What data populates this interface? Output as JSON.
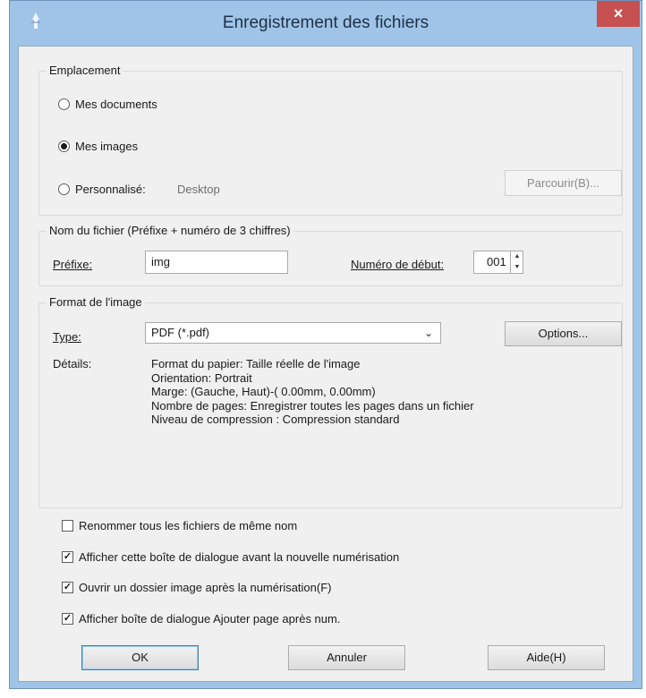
{
  "window": {
    "title": "Enregistrement des fichiers",
    "close_label": "×"
  },
  "location": {
    "legend": "Emplacement",
    "options": [
      {
        "label": "Mes documents",
        "checked": false
      },
      {
        "label": "Mes images",
        "checked": true
      },
      {
        "label": "Personnalisé:",
        "checked": false
      }
    ],
    "custom_path": "Desktop",
    "browse_label": "Parcourir(B)..."
  },
  "filename": {
    "legend": "Nom du fichier (Préfixe + numéro de 3 chiffres)",
    "prefix_label": "Préfixe:",
    "prefix_value": "img",
    "start_number_label": "Numéro de début:",
    "start_number_value": "001"
  },
  "image_format": {
    "legend": "Format de l'image",
    "type_label": "Type:",
    "type_value": "PDF (*.pdf)",
    "options_label": "Options...",
    "details_label": "Détails:",
    "details": [
      "Format du papier: Taille réelle de l'image",
      "Orientation: Portrait",
      "Marge: (Gauche, Haut)-( 0.00mm, 0.00mm)",
      "Nombre de pages: Enregistrer toutes les pages dans un fichier",
      "Niveau de compression : Compression standard"
    ]
  },
  "checkboxes": [
    {
      "label": "Renommer tous les fichiers de même nom",
      "checked": false
    },
    {
      "label": "Afficher cette boîte de dialogue avant la nouvelle numérisation",
      "checked": true
    },
    {
      "label": "Ouvrir un dossier image après la numérisation(F)",
      "checked": true
    },
    {
      "label": "Afficher boîte de dialogue Ajouter page après num.",
      "checked": true
    }
  ],
  "buttons": {
    "ok": "OK",
    "cancel": "Annuler",
    "help": "Aide(H)"
  }
}
